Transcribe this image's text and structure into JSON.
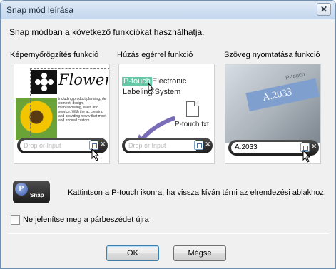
{
  "window": {
    "title": "Snap mód leírása",
    "close_label": "✕"
  },
  "intro": "Snap módban a következő funkciókat használhatja.",
  "panels": [
    {
      "label": "Képernyőrögzítés funkció",
      "doc_title": "Flower",
      "doc_text": "including product planning, de opment, design, manufacturing, sales and service. With the ac creating and providing new v that meet and exceed custom",
      "drop_text": "Drop or Input"
    },
    {
      "label": "Húzás egérrel funkció",
      "highlight": "P-touch",
      "line1": "Electronic",
      "line2": "Labeling System",
      "filename": "P-touch.txt",
      "drop_text": "Drop or Input"
    },
    {
      "label": "Szöveg nyomtatása funkció",
      "brand": "P-touch",
      "label_text": "A.2033",
      "drop_text": "A.2033"
    }
  ],
  "snap_badge": {
    "circle": "P",
    "word": "Snap"
  },
  "info": "Kattintson a P-touch ikonra, ha vissza kíván térni az elrendezési ablakhoz.",
  "checkbox_label": "Ne jelenítse meg a párbeszédet újra",
  "buttons": {
    "ok": "OK",
    "cancel": "Mégse"
  },
  "colors": {
    "highlight": "#66c7a6",
    "tape": "#7f9fcf",
    "default_button_border": "#3c7fb1"
  }
}
